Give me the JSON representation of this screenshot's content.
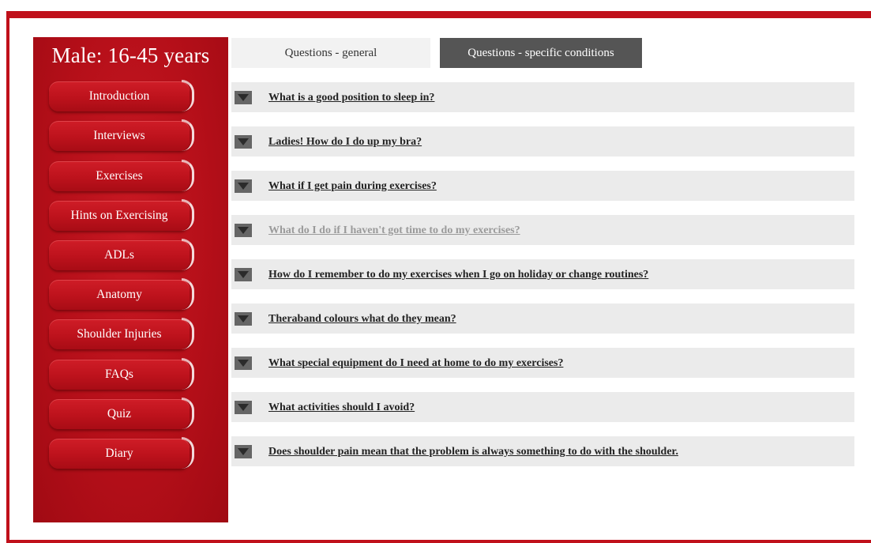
{
  "sidebar": {
    "title": "Male: 16-45 years",
    "items": [
      {
        "label": "Introduction"
      },
      {
        "label": "Interviews"
      },
      {
        "label": "Exercises"
      },
      {
        "label": "Hints on Exercising"
      },
      {
        "label": "ADLs"
      },
      {
        "label": "Anatomy"
      },
      {
        "label": "Shoulder Injuries"
      },
      {
        "label": "FAQs"
      },
      {
        "label": "Quiz"
      },
      {
        "label": "Diary"
      }
    ]
  },
  "tabs": [
    {
      "label": "Questions - general"
    },
    {
      "label": "Questions - specific conditions"
    }
  ],
  "faq": {
    "questions": [
      {
        "text": "What is a good position to sleep in?"
      },
      {
        "text": "Ladies! How do I do up my bra?"
      },
      {
        "text": "What if I get pain during exercises?"
      },
      {
        "text": "What do I do if I haven't got time to do my exercises?"
      },
      {
        "text": "How do I remember to do my exercises when I go on holiday or change routines?"
      },
      {
        "text": "Theraband colours what do they mean?"
      },
      {
        "text": "What special equipment do I need at home to do my exercises?"
      },
      {
        "text": "What activities should I avoid?"
      },
      {
        "text": "Does shoulder pain mean that the problem is always something to do with the shoulder."
      }
    ]
  },
  "colors": {
    "brand_red": "#c0101a",
    "active_tab": "#555555",
    "row_background": "#ebebeb",
    "faded_link": "#9a9a9a"
  },
  "icons": {
    "question_toggle": "triangle-down-icon"
  }
}
